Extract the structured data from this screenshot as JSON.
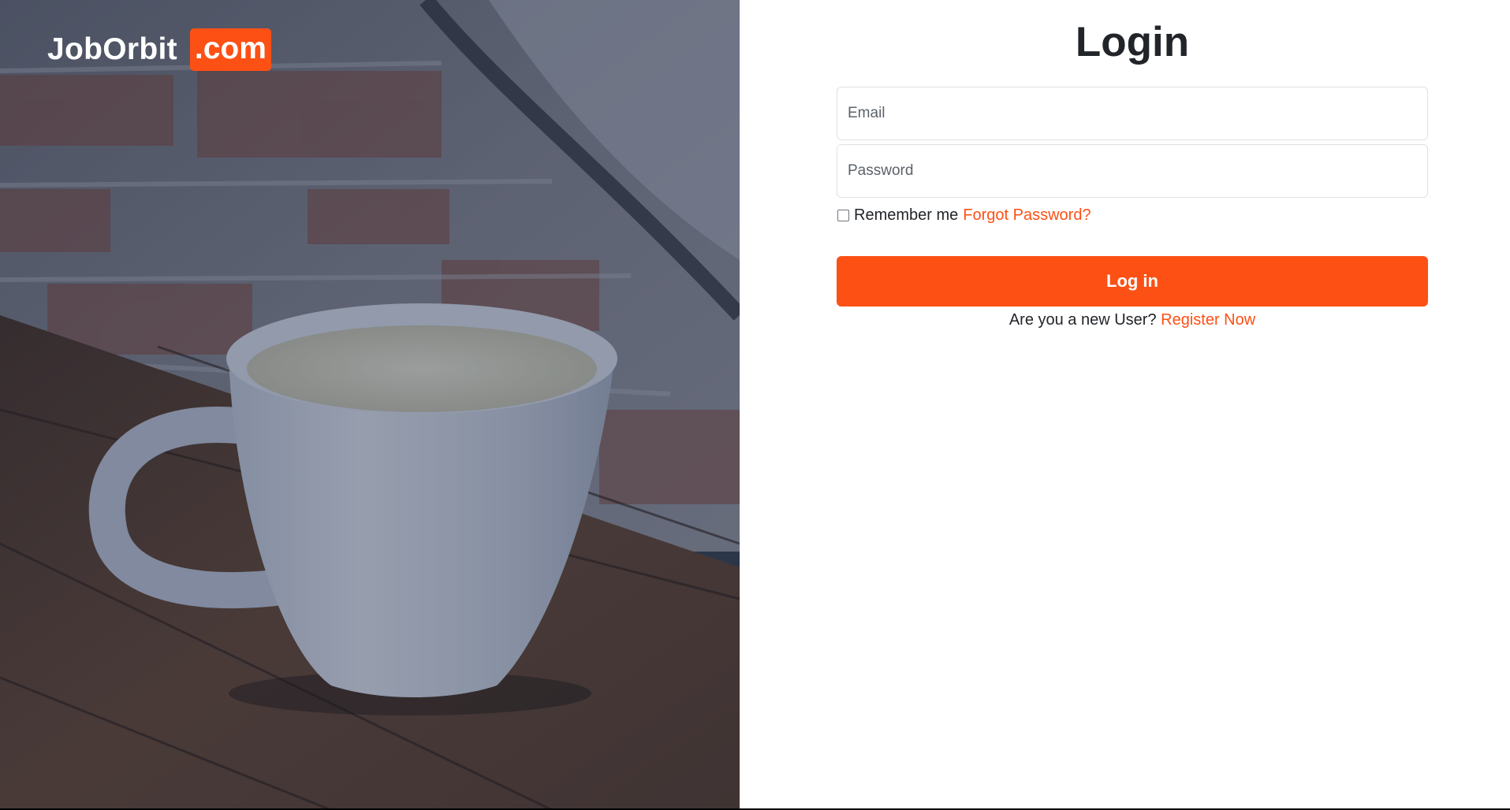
{
  "brand": {
    "name": "JobOrbit",
    "tld": ".com"
  },
  "login": {
    "title": "Login",
    "email_placeholder": "Email",
    "password_placeholder": "Password",
    "remember_label": "Remember me",
    "forgot_link": "Forgot Password?",
    "submit_label": "Log in",
    "new_user_prompt": "Are you a new User?",
    "register_link": "Register Now"
  },
  "colors": {
    "accent": "#fd5015",
    "text": "#212529",
    "border": "#dee2e6"
  }
}
